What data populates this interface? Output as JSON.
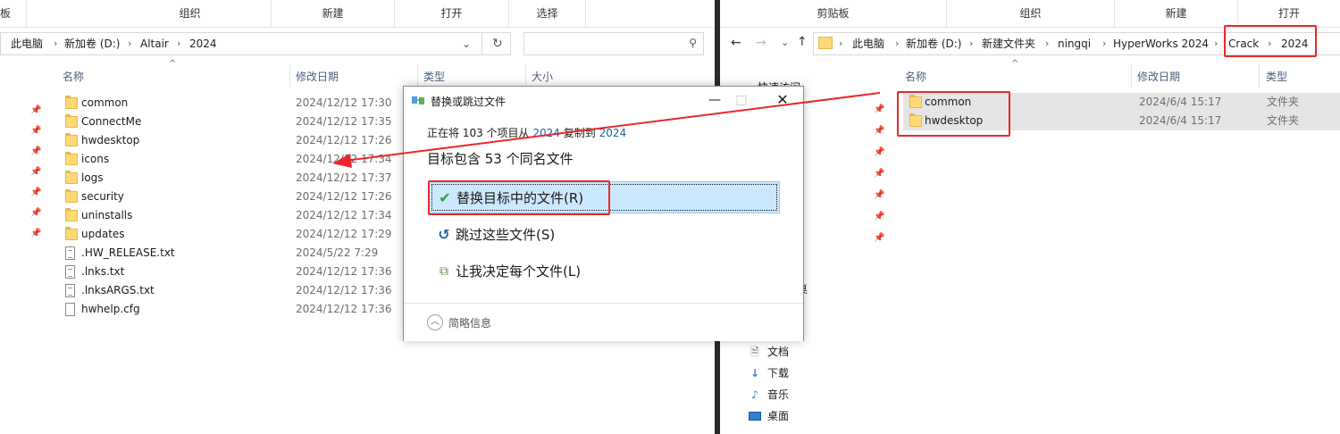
{
  "left": {
    "ribbon": [
      "板",
      "组织",
      "新建",
      "打开",
      "选择"
    ],
    "breadcrumb": [
      "此电脑",
      "新加卷 (D:)",
      "Altair",
      "2024"
    ],
    "columns": {
      "name": "名称",
      "date": "修改日期",
      "type": "类型",
      "size": "大小"
    },
    "files": [
      {
        "name": "common",
        "date": "2024/12/12 17:30",
        "kind": "folder"
      },
      {
        "name": "ConnectMe",
        "date": "2024/12/12 17:35",
        "kind": "folder"
      },
      {
        "name": "hwdesktop",
        "date": "2024/12/12 17:26",
        "kind": "folder"
      },
      {
        "name": "icons",
        "date": "2024/12/12 17:34",
        "kind": "folder"
      },
      {
        "name": "logs",
        "date": "2024/12/12 17:37",
        "kind": "folder"
      },
      {
        "name": "security",
        "date": "2024/12/12 17:26",
        "kind": "folder"
      },
      {
        "name": "uninstalls",
        "date": "2024/12/12 17:34",
        "kind": "folder"
      },
      {
        "name": "updates",
        "date": "2024/12/12 17:29",
        "kind": "folder"
      },
      {
        "name": ".HW_RELEASE.txt",
        "date": "2024/5/22 7:29",
        "kind": "text"
      },
      {
        "name": ".lnks.txt",
        "date": "2024/12/12 17:36",
        "kind": "text"
      },
      {
        "name": ".lnksARGS.txt",
        "date": "2024/12/12 17:36",
        "kind": "text"
      },
      {
        "name": "hwhelp.cfg",
        "date": "2024/12/12 17:36",
        "kind": "file"
      }
    ]
  },
  "right": {
    "ribbon": [
      "剪贴板",
      "组织",
      "新建",
      "打开"
    ],
    "breadcrumb": [
      "此电脑",
      "新加卷 (D:)",
      "新建文件夹",
      "ningqi",
      "HyperWorks 2024",
      "Crack",
      "2024"
    ],
    "columns": {
      "name": "名称",
      "date": "修改日期",
      "type": "类型"
    },
    "files": [
      {
        "name": "common",
        "date": "2024/6/4 15:17",
        "type": "文件夹"
      },
      {
        "name": "hwdesktop",
        "date": "2024/6/4 15:17",
        "type": "文件夹"
      }
    ],
    "nav": [
      {
        "label": "文档",
        "icon": "document-icon"
      },
      {
        "label": "下载",
        "icon": "download-icon"
      },
      {
        "label": "音乐",
        "icon": "music-icon"
      },
      {
        "label": "桌面",
        "icon": "desktop-icon"
      }
    ],
    "nav_partial": [
      "快速访问",
      "桌"
    ]
  },
  "dialog": {
    "title": "替换或跳过文件",
    "line1_prefix": "正在将 103 个项目从",
    "source": "2024",
    "line1_middle": "复制到",
    "dest": "2024",
    "line2": "目标包含 53 个同名文件",
    "option_replace": "替换目标中的文件(R)",
    "option_skip": "跳过这些文件(S)",
    "option_decide": "让我决定每个文件(L)",
    "more_info": "简略信息"
  }
}
